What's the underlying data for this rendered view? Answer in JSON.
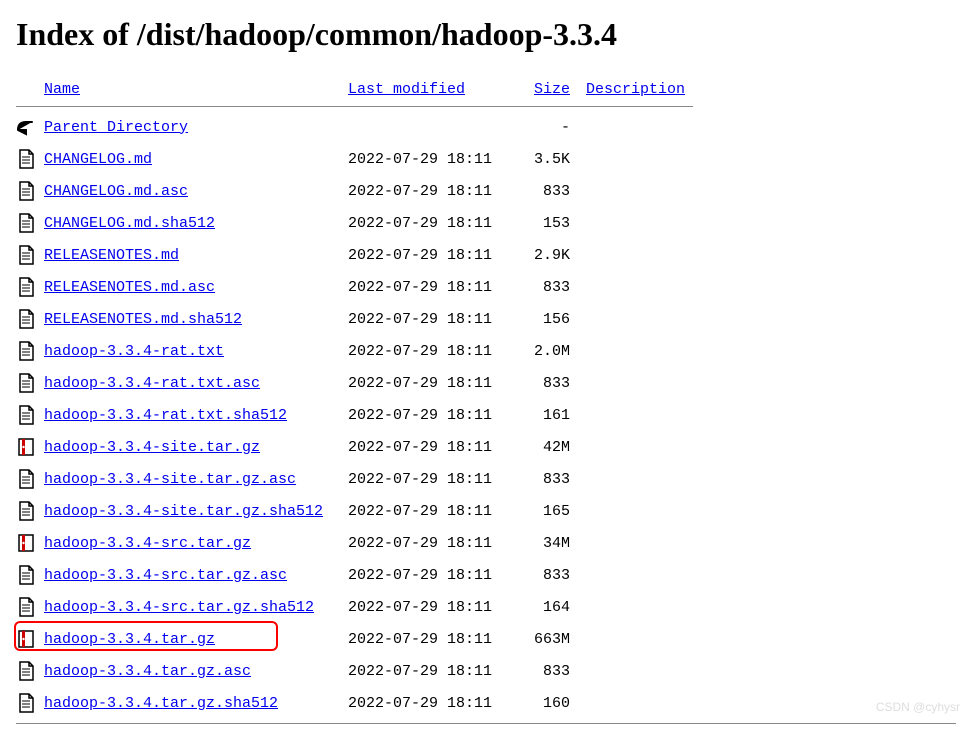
{
  "title": "Index of /dist/hadoop/common/hadoop-3.3.4",
  "columns": {
    "name": "Name",
    "modified": "Last modified",
    "size": "Size",
    "description": "Description"
  },
  "parent": {
    "label": "Parent Directory",
    "size": "-"
  },
  "files": [
    {
      "icon": "text",
      "name": "CHANGELOG.md",
      "modified": "2022-07-29 18:11",
      "size": "3.5K",
      "highlight": false
    },
    {
      "icon": "text",
      "name": "CHANGELOG.md.asc",
      "modified": "2022-07-29 18:11",
      "size": "833",
      "highlight": false
    },
    {
      "icon": "text",
      "name": "CHANGELOG.md.sha512",
      "modified": "2022-07-29 18:11",
      "size": "153",
      "highlight": false
    },
    {
      "icon": "text",
      "name": "RELEASENOTES.md",
      "modified": "2022-07-29 18:11",
      "size": "2.9K",
      "highlight": false
    },
    {
      "icon": "text",
      "name": "RELEASENOTES.md.asc",
      "modified": "2022-07-29 18:11",
      "size": "833",
      "highlight": false
    },
    {
      "icon": "text",
      "name": "RELEASENOTES.md.sha512",
      "modified": "2022-07-29 18:11",
      "size": "156",
      "highlight": false
    },
    {
      "icon": "text",
      "name": "hadoop-3.3.4-rat.txt",
      "modified": "2022-07-29 18:11",
      "size": "2.0M",
      "highlight": false
    },
    {
      "icon": "text",
      "name": "hadoop-3.3.4-rat.txt.asc",
      "modified": "2022-07-29 18:11",
      "size": "833",
      "highlight": false
    },
    {
      "icon": "text",
      "name": "hadoop-3.3.4-rat.txt.sha512",
      "modified": "2022-07-29 18:11",
      "size": "161",
      "highlight": false
    },
    {
      "icon": "archive",
      "name": "hadoop-3.3.4-site.tar.gz",
      "modified": "2022-07-29 18:11",
      "size": " 42M",
      "highlight": false
    },
    {
      "icon": "text",
      "name": "hadoop-3.3.4-site.tar.gz.asc",
      "modified": "2022-07-29 18:11",
      "size": "833",
      "highlight": false
    },
    {
      "icon": "text",
      "name": "hadoop-3.3.4-site.tar.gz.sha512",
      "modified": "2022-07-29 18:11",
      "size": "165",
      "highlight": false
    },
    {
      "icon": "archive",
      "name": "hadoop-3.3.4-src.tar.gz",
      "modified": "2022-07-29 18:11",
      "size": " 34M",
      "highlight": false
    },
    {
      "icon": "text",
      "name": "hadoop-3.3.4-src.tar.gz.asc",
      "modified": "2022-07-29 18:11",
      "size": "833",
      "highlight": false
    },
    {
      "icon": "text",
      "name": "hadoop-3.3.4-src.tar.gz.sha512",
      "modified": "2022-07-29 18:11",
      "size": "164",
      "highlight": false
    },
    {
      "icon": "archive",
      "name": "hadoop-3.3.4.tar.gz",
      "modified": "2022-07-29 18:11",
      "size": "663M",
      "highlight": true
    },
    {
      "icon": "text",
      "name": "hadoop-3.3.4.tar.gz.asc",
      "modified": "2022-07-29 18:11",
      "size": "833",
      "highlight": false
    },
    {
      "icon": "text",
      "name": "hadoop-3.3.4.tar.gz.sha512",
      "modified": "2022-07-29 18:11",
      "size": "160",
      "highlight": false
    }
  ],
  "watermark": "CSDN @cyhysr"
}
